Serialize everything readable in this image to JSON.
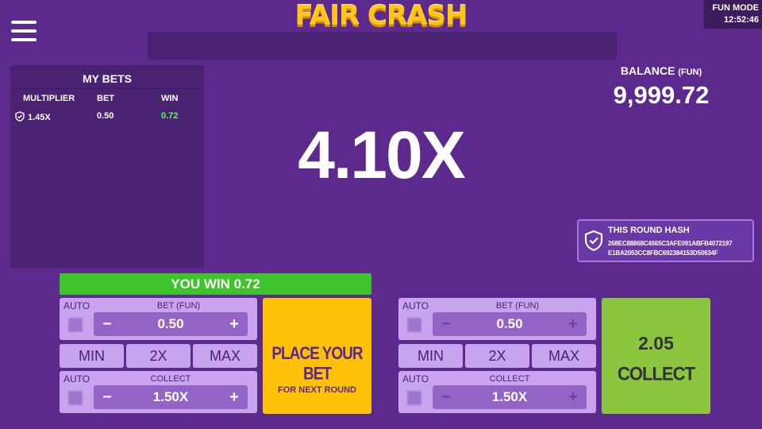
{
  "app": {
    "title": "FAIR CRASH"
  },
  "header": {
    "mode": "FUN MODE",
    "clock": "12:52:46"
  },
  "my_bets": {
    "title": "MY BETS",
    "columns": [
      "MULTIPLIER",
      "BET",
      "WIN"
    ],
    "rows": [
      {
        "multiplier": "1.45X",
        "bet": "0.50",
        "win": "0.72"
      }
    ]
  },
  "balance": {
    "label": "BALANCE",
    "unit": "(FUN)",
    "value": "9,999.72"
  },
  "multiplier": "4.10X",
  "hash": {
    "title": "THIS ROUND HASH",
    "line1": "268EC88868C4665C3AFE091ABFB4072197",
    "line2": "E1BA2053CC8FBC692384153D50634F"
  },
  "win_banner": "YOU WIN 0.72",
  "panel_left": {
    "auto_label": "AUTO",
    "bet_label": "BET (FUN)",
    "bet_value": "0.50",
    "min_label": "MIN",
    "x2_label": "2X",
    "max_label": "MAX",
    "collect_label": "COLLECT",
    "collect_value": "1.50X",
    "action_line1": "PLACE YOUR BET",
    "action_line2": "FOR NEXT ROUND"
  },
  "panel_right": {
    "auto_label": "AUTO",
    "bet_label": "BET (FUN)",
    "bet_value": "0.50",
    "min_label": "MIN",
    "x2_label": "2X",
    "max_label": "MAX",
    "collect_label": "COLLECT",
    "collect_value": "1.50X",
    "action_amount": "2.05",
    "action_label": "COLLECT"
  },
  "colors": {
    "background": "#5b2a8c",
    "win_green": "#3dc42a",
    "place_yellow": "#ffc107",
    "collect_green": "#8cc63f",
    "logo_yellow": "#ffc61a"
  },
  "icons": {
    "menu": "hamburger-icon",
    "shield": "shield-check-icon",
    "minus": "minus-icon",
    "plus": "plus-icon"
  }
}
